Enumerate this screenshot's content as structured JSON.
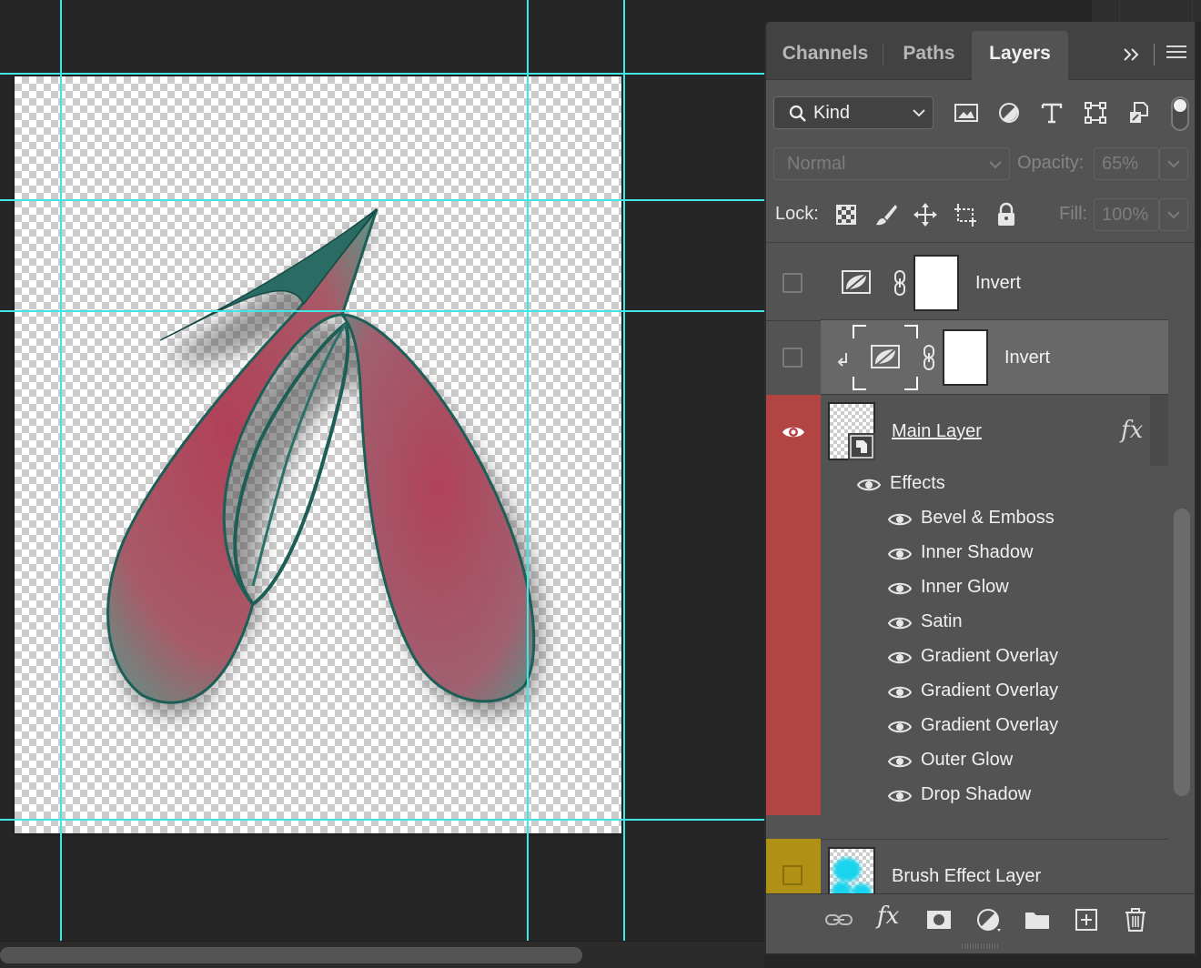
{
  "panel": {
    "tabs": [
      {
        "label": "Channels",
        "active": false
      },
      {
        "label": "Paths",
        "active": false
      },
      {
        "label": "Layers",
        "active": true
      }
    ],
    "collapse_icon": "double-chevron-right-icon",
    "menu_icon": "hamburger-menu-icon"
  },
  "filter": {
    "kind_label": "Kind",
    "icons": [
      "image-filter-icon",
      "adjustment-filter-icon",
      "type-filter-icon",
      "shape-filter-icon",
      "smart-object-filter-icon"
    ]
  },
  "blend": {
    "mode": "Normal",
    "opacity_label": "Opacity:",
    "opacity_value": "65%"
  },
  "lock": {
    "label": "Lock:",
    "fill_label": "Fill:",
    "fill_value": "100%"
  },
  "layers": [
    {
      "name": "Invert",
      "type": "adjustment",
      "visible": false,
      "selected": false,
      "clipped": false
    },
    {
      "name": "Invert",
      "type": "adjustment",
      "visible": false,
      "selected": true,
      "clipped": true
    },
    {
      "name": "Main Layer",
      "type": "smart-object",
      "visible": true,
      "selected": false,
      "color_tag": "#b34444",
      "has_fx": true,
      "fx_label": "fx"
    },
    {
      "name": "Brush Effect Layer",
      "type": "pixel",
      "visible": false,
      "selected": false,
      "color_tag": "#b09015"
    }
  ],
  "effects": {
    "header": "Effects",
    "items": [
      "Bevel & Emboss",
      "Inner Shadow",
      "Inner Glow",
      "Satin",
      "Gradient Overlay",
      "Gradient Overlay",
      "Gradient Overlay",
      "Outer Glow",
      "Drop Shadow"
    ]
  },
  "bottom_bar": {
    "fx_label": "fx",
    "icons": [
      "link-layers-icon",
      "add-style-icon",
      "add-mask-icon",
      "new-adjustment-icon",
      "new-group-icon",
      "new-layer-icon",
      "delete-layer-icon"
    ]
  },
  "colors": {
    "guide": "#3ee6e6",
    "red_tag": "#b34444",
    "yellow_tag": "#b09015",
    "panel_bg": "#535353",
    "selected_row": "#686868"
  }
}
